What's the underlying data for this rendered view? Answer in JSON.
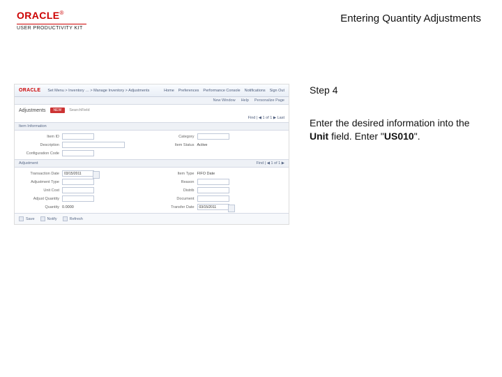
{
  "header": {
    "brand": "ORACLE",
    "kit": "USER PRODUCTIVITY KIT",
    "title": "Entering Quantity Adjustments"
  },
  "step": {
    "label": "Step 4",
    "text_before": "Enter the desired information into the ",
    "field_name": "Unit",
    "text_mid": " field. Enter \"",
    "value": "US010",
    "text_after": "\"."
  },
  "shot": {
    "brand": "ORACLE",
    "breadcrumb": "Set Menu > Inventory … > Manage Inventory > Adjustments",
    "nav": [
      "Home",
      "Preferences",
      "Performance Console",
      "Notifications",
      "Sign Out"
    ],
    "subnav": [
      "New Window",
      "Help",
      "Personalize Page"
    ],
    "page_title": "Adjustments",
    "status": "NEW",
    "paginator": "Find | ◀ 1 of 1 ▶ Last",
    "section1": "Item Information",
    "fields1": [
      {
        "label": "Item ID",
        "value": ""
      },
      {
        "label": "Category",
        "value": ""
      },
      {
        "label": "Description",
        "value": ""
      },
      {
        "label": "Item Status",
        "value": "Active"
      },
      {
        "label": "Configuration Code",
        "value": ""
      }
    ],
    "section2": "Adjustment",
    "sec2_right": "Find | ◀ 1 of 1 ▶",
    "fields2": [
      {
        "label": "Transaction Date",
        "value": "03/15/2011"
      },
      {
        "label": "Item Type",
        "value": "FIFO Date"
      },
      {
        "label": "Adjustment Type",
        "value": ""
      },
      {
        "label": "Reason",
        "value": ""
      },
      {
        "label": "Unit Cost",
        "value": ""
      },
      {
        "label": "Adjust Quantity",
        "value": ""
      },
      {
        "label": "Quantity",
        "value": "0.0000"
      },
      {
        "label": "Transfer Date",
        "value": "03/15/2011"
      },
      {
        "label": "Distrib",
        "value": ""
      },
      {
        "label": "Document",
        "value": ""
      }
    ],
    "foot": [
      "Save",
      "Notify",
      "Refresh"
    ]
  }
}
